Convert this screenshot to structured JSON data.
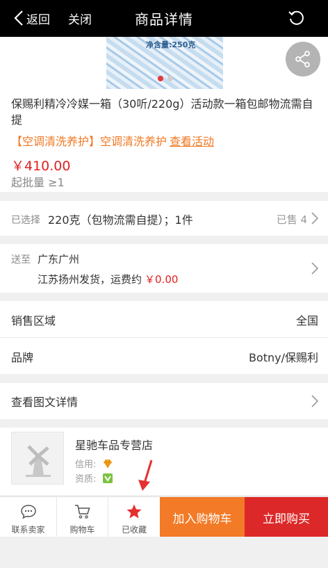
{
  "topbar": {
    "back_label": "返回",
    "close_label": "关闭",
    "title": "商品详情"
  },
  "gallery": {
    "jar_text": "净含量:250克"
  },
  "product": {
    "name": "保赐利精冷冷媒一箱（30听/220g）活动款一箱包邮物流需自提",
    "promo_tag": "【空调清洗养护】空调清洗养护",
    "promo_link": "查看活动",
    "price": "￥410.00",
    "min_qty": "起批量 ≥1"
  },
  "selection": {
    "label": "已选择",
    "value": "220克（包物流需自提）；1件",
    "sold": "已售 4"
  },
  "shipping": {
    "label": "送至",
    "city": "广东广州",
    "from_text": "江苏扬州发货，运费约",
    "fee": "￥0.00"
  },
  "attributes": [
    {
      "key": "销售区域",
      "value": "全国"
    },
    {
      "key": "品牌",
      "value": "Botny/保赐利"
    }
  ],
  "details": {
    "label": "查看图文详情"
  },
  "shop": {
    "name": "星驰车品专营店",
    "credit_label": "信用:",
    "qual_label": "资质:"
  },
  "bottombar": {
    "contact_label": "联系卖家",
    "cart_label": "购物车",
    "fav_label": "已收藏",
    "add_cart_label": "加入购物车",
    "buy_label": "立即购买"
  },
  "colors": {
    "accent_red": "#dc2828",
    "accent_orange": "#f37a26",
    "promo_orange": "#f07823"
  }
}
